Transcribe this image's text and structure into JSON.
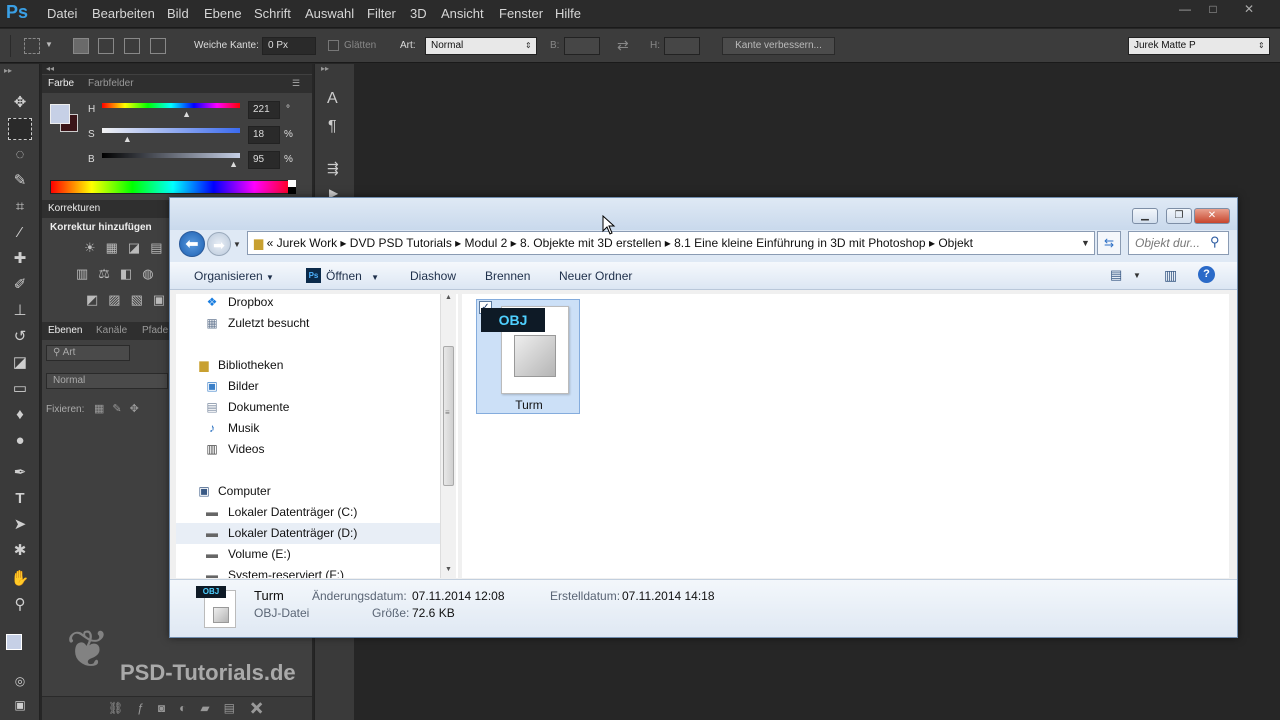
{
  "app": {
    "logo": "Ps"
  },
  "menu": [
    "Datei",
    "Bearbeiten",
    "Bild",
    "Ebene",
    "Schrift",
    "Auswahl",
    "Filter",
    "3D",
    "Ansicht",
    "Fenster",
    "Hilfe"
  ],
  "window_controls": {
    "minimize": "—",
    "maximize": "□",
    "close": "✕"
  },
  "options": {
    "feather_label": "Weiche Kante:",
    "feather_value": "0 Px",
    "antialias_label": "Glätten",
    "style_label": "Art:",
    "style_value": "Normal",
    "width_label": "B:",
    "height_label": "H:",
    "refine_button": "Kante verbessern...",
    "workspace": "Jurek Matte P"
  },
  "color_panel": {
    "tab_color": "Farbe",
    "tab_swatches": "Farbfelder",
    "h_label": "H",
    "h_value": "221",
    "h_unit": "°",
    "h_level": 0.61,
    "s_label": "S",
    "s_value": "18",
    "s_unit": "%",
    "s_level": 0.18,
    "b_label": "B",
    "b_value": "95",
    "b_unit": "%",
    "b_level": 0.95,
    "fg_color": "#c6d0e6",
    "bg_color": "#3a1418"
  },
  "corrections_panel": {
    "tab": "Korrekturen",
    "heading": "Korrektur hinzufügen"
  },
  "layers_panel": {
    "tab_layers": "Ebenen",
    "tab_channels": "Kanäle",
    "tab_paths": "Pfade",
    "filter_placeholder": "Art",
    "blend_mode": "Normal",
    "lock_label": "Fixieren:"
  },
  "explorer": {
    "title_buttons": {
      "minimize": "▁",
      "maximize": "❐",
      "close": "✕"
    },
    "breadcrumb": [
      "«",
      "Jurek Work",
      "DVD PSD Tutorials",
      "Modul 2",
      "8. Objekte mit 3D erstellen",
      "8.1 Eine kleine Einführung in 3D mit Photoshop",
      "Objekt"
    ],
    "search_placeholder": "Objekt dur...",
    "commands": {
      "organize": "Organisieren",
      "open": "Öffnen",
      "slideshow": "Diashow",
      "burn": "Brennen",
      "new_folder": "Neuer Ordner"
    },
    "nav": {
      "dropbox": "Dropbox",
      "recent": "Zuletzt besucht",
      "libraries": "Bibliotheken",
      "pictures": "Bilder",
      "documents": "Dokumente",
      "music": "Musik",
      "videos": "Videos",
      "computer": "Computer",
      "drive_c": "Lokaler Datenträger (C:)",
      "drive_d": "Lokaler Datenträger (D:)",
      "drive_e": "Volume (E:)",
      "drive_f": "System-reserviert (F:)"
    },
    "file": {
      "badge": "OBJ",
      "name": "Turm"
    },
    "status": {
      "name": "Turm",
      "type": "OBJ-Datei",
      "modified_label": "Änderungsdatum:",
      "modified_value": "07.11.2014 12:08",
      "created_label": "Erstelldatum:",
      "created_value": "07.11.2014 14:18",
      "size_label": "Größe:",
      "size_value": "72.6 KB"
    }
  },
  "watermark": {
    "text": "PSD-Tutorials.de"
  }
}
